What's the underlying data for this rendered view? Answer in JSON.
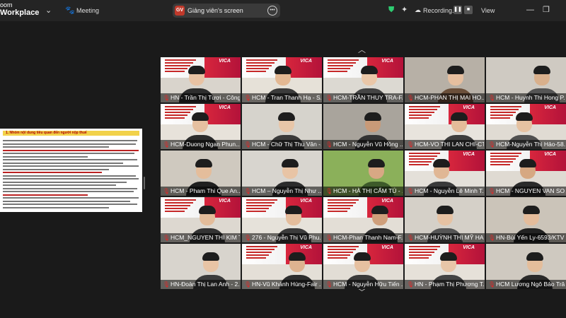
{
  "app": {
    "logo_line1": "oom",
    "logo_line2": "Workplace"
  },
  "topbar": {
    "meeting_label": "Meeting",
    "screen_initials": "GV",
    "screen_label": "Giảng viên's screen",
    "recording_label": "Recording...",
    "view_label": "View"
  },
  "shared": {
    "heading": "1. Nhóm nội dung tiêu quan đến người nộp thuế"
  },
  "participants": [
    {
      "name": "HN - Trần Thị Tươi - Công..."
    },
    {
      "name": "HCM - Tran Thanh Hạ - S..."
    },
    {
      "name": "HCM-TRẦN THUY TRA-FA..."
    },
    {
      "name": "HCM-PHAN THỊ MAI HO..."
    },
    {
      "name": "HCM - Huynh Thi Hong P..."
    },
    {
      "name": "HCM-Duong Ngan Phun..."
    },
    {
      "name": "HCM - Chữ Thị Thu Vân -..."
    },
    {
      "name": "HCM - Nguyễn Vũ Hồng ..."
    },
    {
      "name": "HCM-VO THI LAN CHI-CT..."
    },
    {
      "name": "HCM-Nguyễn Thị Hảo-58..."
    },
    {
      "name": "HCM - Pham Thi Que An..."
    },
    {
      "name": "HCM – Nguyễn Thị Như ..."
    },
    {
      "name": "HCM - HÀ THỊ CẨM TÚ - ..."
    },
    {
      "name": "HCM - Nguyễn Lê Minh T..."
    },
    {
      "name": "HCM - NGUYEN VAN SO..."
    },
    {
      "name": "HCM_NGUYEN THI KIM T..."
    },
    {
      "name": "276 - Nguyễn Thị Vũ Phu..."
    },
    {
      "name": "HCM-Phan Thanh Nam-F..."
    },
    {
      "name": "HCM-HUỲNH THỊ MỸ HA ..."
    },
    {
      "name": "HN-Bùi Yến Ly-6593/KTV"
    },
    {
      "name": "HN-Đoàn Thị Lan Anh - 2..."
    },
    {
      "name": "HN-Vũ Khánh Hùng-Fair ..."
    },
    {
      "name": "HCM - Nguyễn Hữu Tiến ..."
    },
    {
      "name": "HN - Phạm Thị Phương T..."
    },
    {
      "name": "HCM Lương Ngô Bảo Trâ..."
    }
  ],
  "slide_logo": "VICA"
}
